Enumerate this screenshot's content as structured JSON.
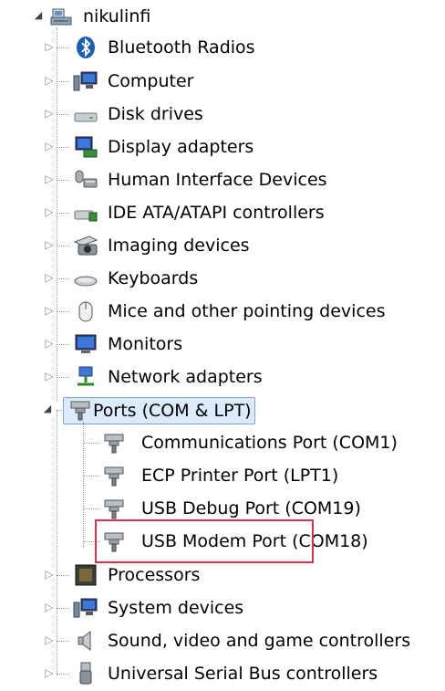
{
  "root": {
    "label": "nikulinfi",
    "icon": "computer-icon"
  },
  "categories": [
    {
      "label": "Bluetooth Radios",
      "icon": "bluetooth-icon"
    },
    {
      "label": "Computer",
      "icon": "computer-icon"
    },
    {
      "label": "Disk drives",
      "icon": "disk-drive-icon"
    },
    {
      "label": "Display adapters",
      "icon": "display-adapter-icon"
    },
    {
      "label": "Human Interface Devices",
      "icon": "hid-icon"
    },
    {
      "label": "IDE ATA/ATAPI controllers",
      "icon": "ide-controller-icon"
    },
    {
      "label": "Imaging devices",
      "icon": "camera-icon"
    },
    {
      "label": "Keyboards",
      "icon": "keyboard-icon"
    },
    {
      "label": "Mice and other pointing devices",
      "icon": "mouse-icon"
    },
    {
      "label": "Monitors",
      "icon": "monitor-icon"
    },
    {
      "label": "Network adapters",
      "icon": "network-icon"
    }
  ],
  "ports": {
    "label": "Ports (COM & LPT)",
    "icon": "port-icon",
    "children": [
      {
        "label": "Communications Port (COM1)",
        "icon": "port-icon"
      },
      {
        "label": "ECP Printer Port (LPT1)",
        "icon": "port-icon"
      },
      {
        "label": "USB Debug Port (COM19)",
        "icon": "port-icon"
      },
      {
        "label": "USB Modem Port (COM18)",
        "icon": "port-icon",
        "highlighted_text": "USB Modem Port"
      }
    ]
  },
  "categories_after": [
    {
      "label": "Processors",
      "icon": "processor-icon"
    },
    {
      "label": "System devices",
      "icon": "system-device-icon"
    },
    {
      "label": "Sound, video and game controllers",
      "icon": "speaker-icon"
    },
    {
      "label": "Universal Serial Bus controllers",
      "icon": "usb-icon"
    }
  ],
  "colors": {
    "selection_bg": "#dcebfc",
    "selection_border": "#7da2ce",
    "highlight_border": "#d9344d"
  }
}
